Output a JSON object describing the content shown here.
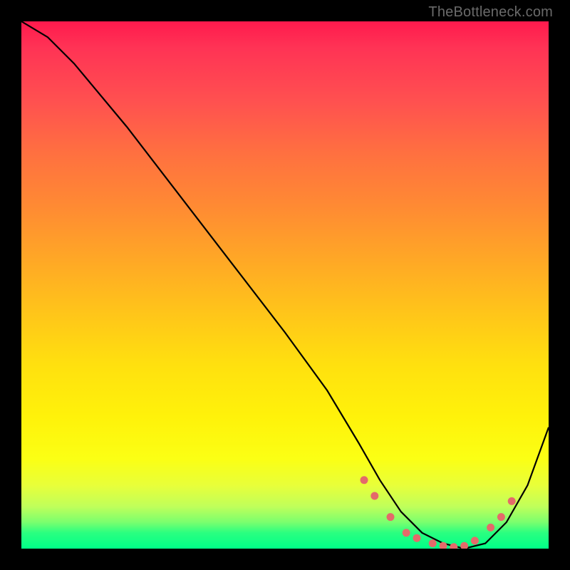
{
  "watermark": "TheBottleneck.com",
  "chart_data": {
    "type": "line",
    "title": "",
    "xlabel": "",
    "ylabel": "",
    "xlim": [
      0,
      100
    ],
    "ylim": [
      0,
      100
    ],
    "curve": {
      "name": "bottleneck-curve",
      "x": [
        0,
        5,
        10,
        20,
        30,
        40,
        50,
        58,
        64,
        68,
        72,
        76,
        80,
        84,
        88,
        92,
        96,
        100
      ],
      "y": [
        100,
        97,
        92,
        80,
        67,
        54,
        41,
        30,
        20,
        13,
        7,
        3,
        1,
        0,
        1,
        5,
        12,
        23
      ]
    },
    "markers": {
      "name": "marker-dots",
      "color": "#e46a6a",
      "points": [
        {
          "x": 65,
          "y": 13
        },
        {
          "x": 67,
          "y": 10
        },
        {
          "x": 70,
          "y": 6
        },
        {
          "x": 73,
          "y": 3
        },
        {
          "x": 75,
          "y": 2
        },
        {
          "x": 78,
          "y": 1
        },
        {
          "x": 80,
          "y": 0.5
        },
        {
          "x": 82,
          "y": 0.3
        },
        {
          "x": 84,
          "y": 0.5
        },
        {
          "x": 86,
          "y": 1.5
        },
        {
          "x": 89,
          "y": 4
        },
        {
          "x": 91,
          "y": 6
        },
        {
          "x": 93,
          "y": 9
        }
      ]
    },
    "gradient_stops": [
      {
        "pos": 0,
        "color": "#ff1a4d"
      },
      {
        "pos": 50,
        "color": "#ffb020"
      },
      {
        "pos": 80,
        "color": "#fff000"
      },
      {
        "pos": 100,
        "color": "#00ff88"
      }
    ]
  }
}
